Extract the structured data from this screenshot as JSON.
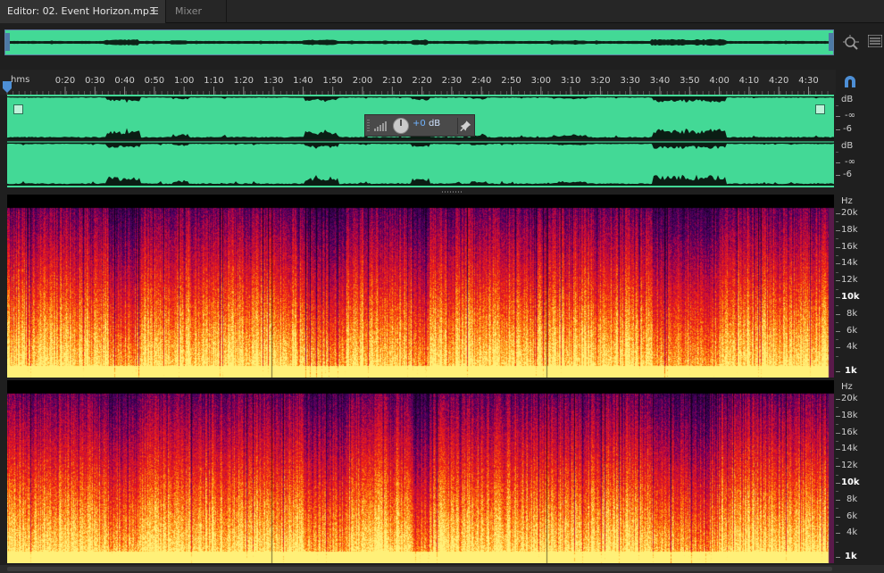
{
  "tabs": {
    "editor_label": "Editor: 02. Event Horizon.mp3",
    "editor_menu_glyph": "☰",
    "mixer_label": "Mixer"
  },
  "ruler": {
    "unit_label": "hms",
    "ticks": [
      "0:20",
      "0:30",
      "0:40",
      "0:50",
      "1:00",
      "1:10",
      "1:20",
      "1:30",
      "1:40",
      "1:50",
      "2:00",
      "2:10",
      "2:20",
      "2:30",
      "2:40",
      "2:50",
      "3:00",
      "3:10",
      "3:20",
      "3:30",
      "3:40",
      "3:50",
      "4:00",
      "4:10",
      "4:20",
      "4:30"
    ]
  },
  "hud": {
    "value_prefix": "+0",
    "value_unit": "dB"
  },
  "amplitude_scale": {
    "channels": [
      {
        "unit": "dB",
        "labels": [
          "-∞",
          "-6"
        ]
      },
      {
        "unit": "dB",
        "labels": [
          "-∞",
          "-6"
        ]
      }
    ]
  },
  "frequency_scale": {
    "unit": "Hz",
    "labels": [
      "20k",
      "18k",
      "16k",
      "14k",
      "12k",
      "10k",
      "8k",
      "6k",
      "4k",
      "1k"
    ]
  },
  "icons": {
    "zoom": "zoom-navigator-icon",
    "panel": "panel-list-icon",
    "snap": "snap-magnet-icon",
    "playhead": "playhead-icon",
    "pin": "pin-icon",
    "knob": "volume-knob-icon"
  },
  "colors": {
    "waveform_bg": "#43d996",
    "waveform_fg": "#0b1d14",
    "accent": "#4d8fd6"
  }
}
